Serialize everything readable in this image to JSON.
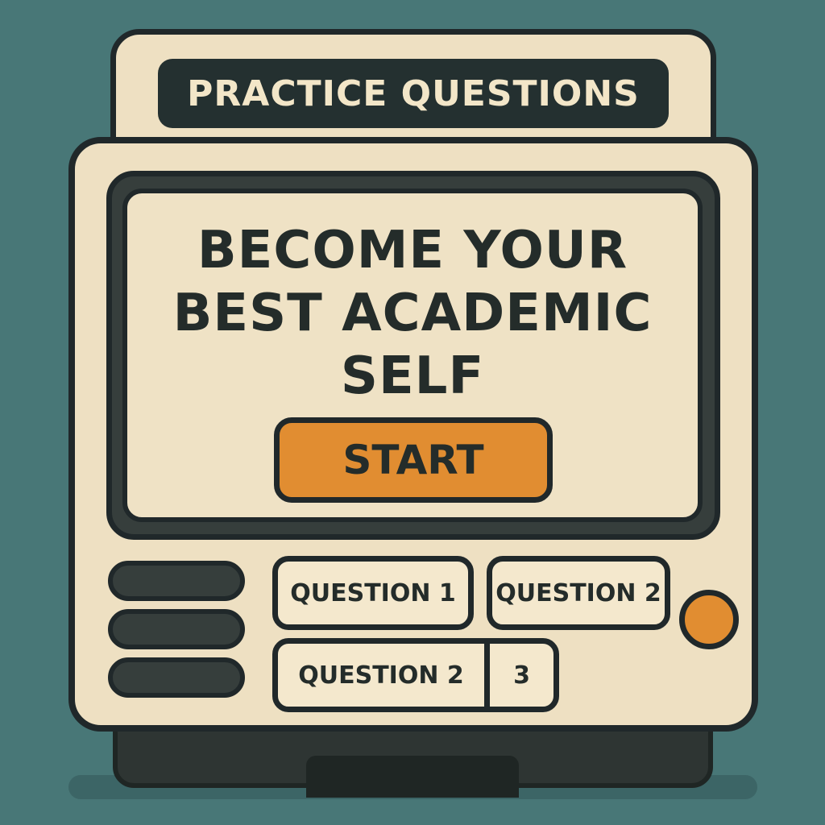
{
  "header": {
    "title": "PRACTICE QUESTIONS"
  },
  "screen": {
    "headline_line1": "BECOME YOUR",
    "headline_line2": "BEST ACADEMIC",
    "headline_line3": "SELF",
    "start_label": "START"
  },
  "controls": {
    "question_1_label": "QUESTION 1",
    "question_2_label": "QUESTION 2",
    "question_group": {
      "left_label": "QUESTION 2",
      "right_label": "3"
    }
  },
  "colors": {
    "background": "#487777",
    "device_body": "#eee0c2",
    "outline": "#20282a",
    "accent_orange": "#e18d31",
    "dark_panel": "#243030"
  },
  "icons": {
    "knob": "circle-knob-icon",
    "speaker": "speaker-slot-icon"
  }
}
